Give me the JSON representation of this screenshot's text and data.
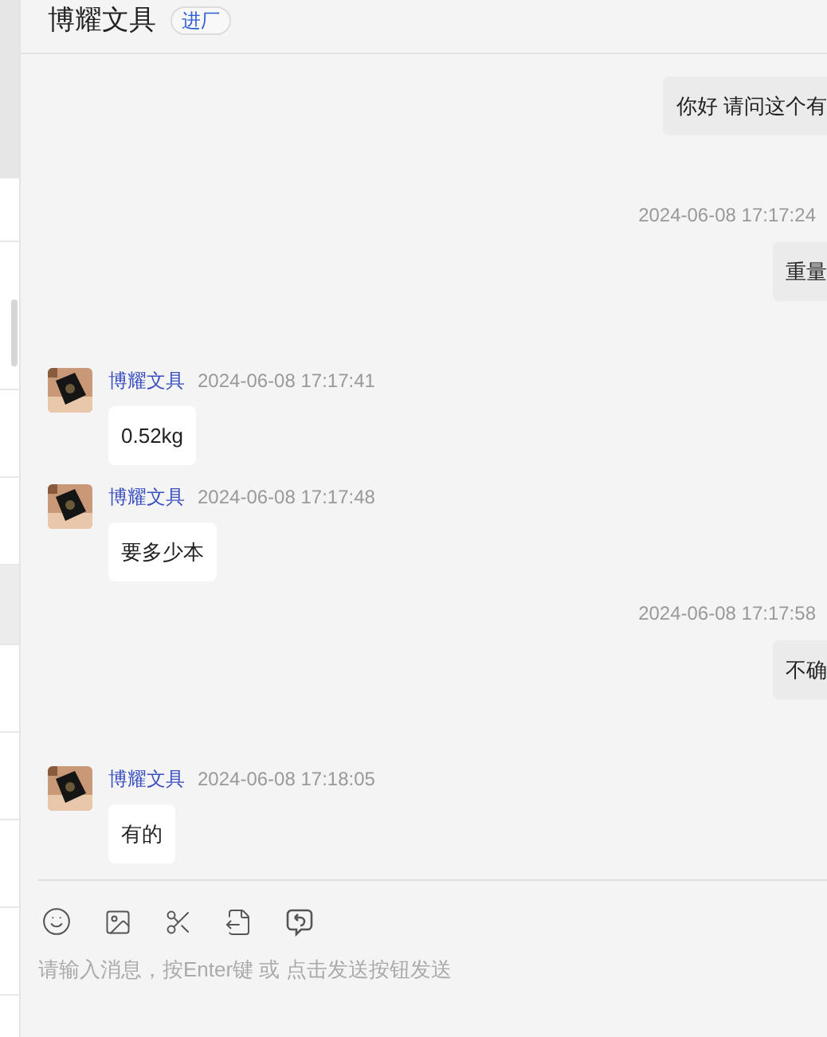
{
  "sidebar": {
    "items": [
      {
        "selected": false
      },
      {
        "selected": false
      },
      {
        "selected": false
      },
      {
        "selected": false
      },
      {
        "selected": true
      },
      {
        "selected": false
      },
      {
        "selected": false
      },
      {
        "selected": false
      },
      {
        "selected": false
      }
    ]
  },
  "header": {
    "title": "博耀文具",
    "badge": "进厂"
  },
  "messages": [
    {
      "kind": "outgoing",
      "text": "你好 请问这个有"
    },
    {
      "kind": "outgoing",
      "time": "2024-06-08 17:17:24",
      "text": "重量"
    },
    {
      "kind": "incoming",
      "sender": "博耀文具",
      "time": "2024-06-08 17:17:41",
      "text": "0.52kg"
    },
    {
      "kind": "incoming",
      "sender": "博耀文具",
      "time": "2024-06-08 17:17:48",
      "text": "要多少本"
    },
    {
      "kind": "outgoing",
      "time": "2024-06-08 17:17:58",
      "text": "不确"
    },
    {
      "kind": "incoming",
      "sender": "博耀文具",
      "time": "2024-06-08 17:18:05",
      "text": "有的"
    }
  ],
  "input": {
    "placeholder": "请输入消息，按Enter键 或 点击发送按钮发送"
  }
}
